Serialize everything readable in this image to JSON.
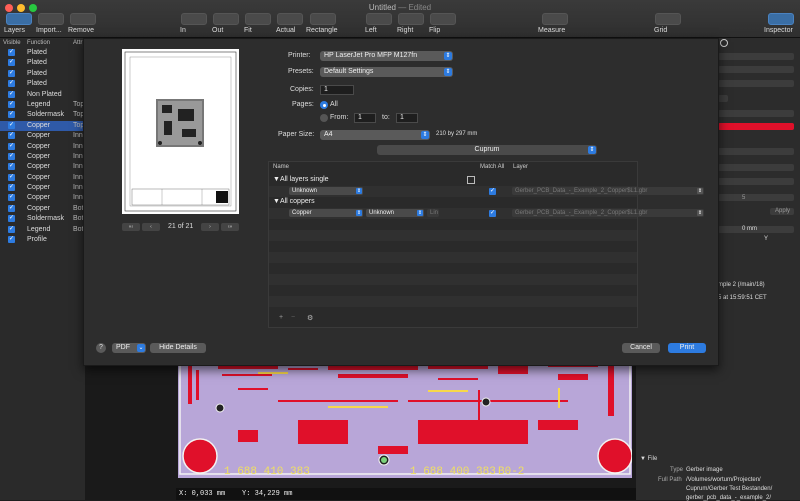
{
  "window": {
    "title": "Untitled",
    "title_suffix": "— Edited"
  },
  "toolbar": {
    "left": [
      {
        "label": "Layers",
        "active": true
      },
      {
        "label": "Import...",
        "active": false
      },
      {
        "label": "Remove",
        "active": false
      }
    ],
    "zoom": [
      "In",
      "Out",
      "Fit",
      "Actual",
      "Rectangle"
    ],
    "mirror": [
      "Left",
      "Right",
      "Flip"
    ],
    "measure": "Measure",
    "grid": "Grid",
    "inspector": "Inspector"
  },
  "layers_panel": {
    "headers": {
      "visible": "Visible",
      "function": "Function",
      "attr": "Attr"
    },
    "rows": [
      {
        "function": "Plated",
        "attr": ""
      },
      {
        "function": "Plated",
        "attr": ""
      },
      {
        "function": "Plated",
        "attr": ""
      },
      {
        "function": "Plated",
        "attr": ""
      },
      {
        "function": "Non Plated",
        "attr": ""
      },
      {
        "function": "Legend",
        "attr": "Top"
      },
      {
        "function": "Soldermask",
        "attr": "Top"
      },
      {
        "function": "Copper",
        "attr": "Top"
      },
      {
        "function": "Copper",
        "attr": "Inn"
      },
      {
        "function": "Copper",
        "attr": "Inn"
      },
      {
        "function": "Copper",
        "attr": "Inn"
      },
      {
        "function": "Copper",
        "attr": "Inn"
      },
      {
        "function": "Copper",
        "attr": "Inn"
      },
      {
        "function": "Copper",
        "attr": "Inn"
      },
      {
        "function": "Copper",
        "attr": "Inn"
      },
      {
        "function": "Copper",
        "attr": "Bot"
      },
      {
        "function": "Soldermask",
        "attr": "Bot"
      },
      {
        "function": "Legend",
        "attr": "Bot"
      },
      {
        "function": "Profile",
        "attr": ""
      }
    ],
    "selected_index": 7
  },
  "print": {
    "printer_label": "Printer:",
    "printer": "HP LaserJet Pro MFP M127fn",
    "presets_label": "Presets:",
    "presets": "Default Settings",
    "copies_label": "Copies:",
    "copies": "1",
    "pages_label": "Pages:",
    "pages_all": "All",
    "pages_from": "From:",
    "from_value": "1",
    "to_label": "to:",
    "to_value": "1",
    "paper_label": "Paper Size:",
    "paper": "A4",
    "paper_dims": "210 by 297 mm",
    "page_counter": "21 of 21",
    "app_section": "Cuprum",
    "table": {
      "headers": {
        "name": "Name",
        "match": "Match All",
        "layer": "Layer"
      },
      "groups": [
        {
          "name": "All layers single",
          "func": "Unknown",
          "attr": "",
          "side": "",
          "layer": "Gerber_PCB_Data_-_Example_2_Copper$L1.gbr"
        },
        {
          "name": "All coppers",
          "func": "Copper",
          "attr": "Unknown",
          "side": "Lin",
          "layer": "Gerber_PCB_Data_-_Example_2_Copper$L1.gbr"
        }
      ]
    },
    "pdf": "PDF",
    "hide_details": "Hide Details",
    "cancel": "Cancel",
    "print": "Print"
  },
  "inspector": {
    "zero_value": "0 mm",
    "col_y": "Y",
    "apply": "Apply",
    "step_value": "5",
    "source_line1": "mple 2 (/main/18)",
    "source_line2": "5 at 15:59:51 CET",
    "file_section": "File",
    "type_label": "Type",
    "type_value": "Gerber image",
    "path_label": "Full Path",
    "path_value_1": "/Volumes/wortum/Projecten/",
    "path_value_2": "Cuprum/Gerber Test Bestanden/",
    "path_value_3": "gerber_pcb_data_-_example_2/"
  },
  "status": {
    "x": "X: 0,033 mm",
    "y": "Y: 34,229 mm"
  },
  "board_text": [
    "1 688 410 383",
    "1 688 400 383",
    "B0-2"
  ],
  "colors": {
    "accent": "#2d7be0",
    "board": "#b8a6d8",
    "pad": "#e0102a"
  }
}
